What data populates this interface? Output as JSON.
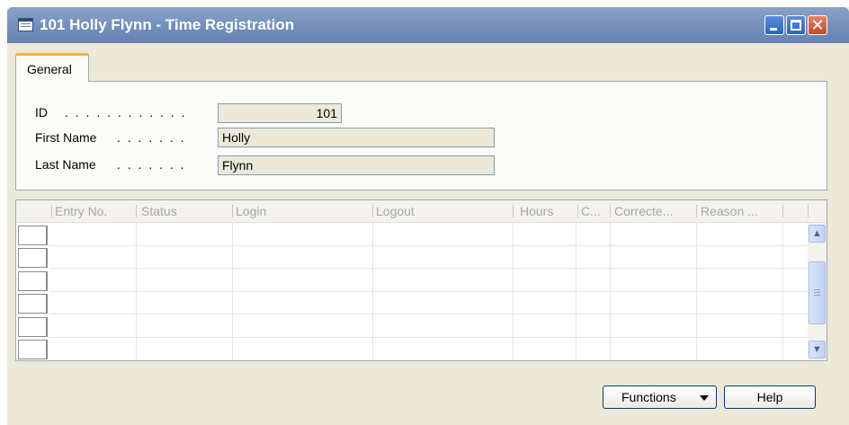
{
  "window": {
    "title": "101 Holly Flynn - Time Registration",
    "icon": "table-window-icon",
    "controls": {
      "minimize": "minimize-icon",
      "maximize": "maximize-icon",
      "close": "close-icon"
    },
    "close_glyph": "✕"
  },
  "tabs": [
    {
      "label": "General"
    }
  ],
  "fields": [
    {
      "label": "ID",
      "dots": ". . . . . . . . . . . .",
      "value": "101"
    },
    {
      "label": "First Name",
      "dots": ". . . . . . .",
      "value": "Holly"
    },
    {
      "label": "Last Name",
      "dots": ". . . . . . .",
      "value": "Flynn"
    }
  ],
  "grid": {
    "columns": [
      "Entry No.",
      "Status",
      "Login",
      "Logout",
      "Hours",
      "C...",
      "Correcte...",
      "Reason ..."
    ],
    "rows": [],
    "scroll_up_glyph": "▲",
    "scroll_down_glyph": "▼"
  },
  "buttons": {
    "functions": "Functions",
    "help": "Help"
  }
}
